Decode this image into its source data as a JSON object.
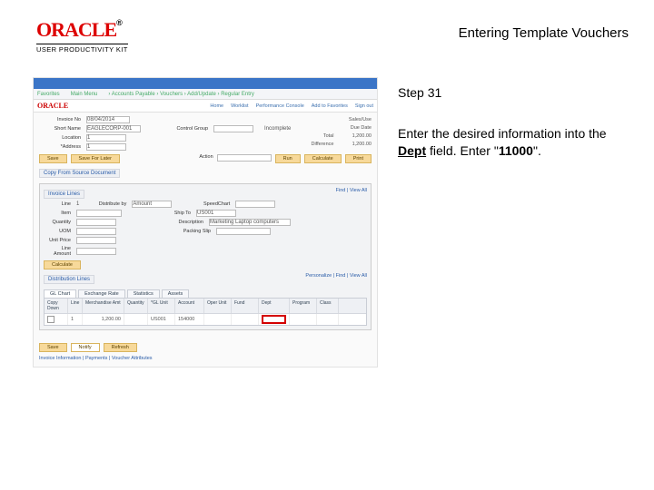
{
  "header": {
    "brand": "ORACLE",
    "brand_tm": "®",
    "subtitle": "USER PRODUCTIVITY KIT",
    "title": "Entering Template Vouchers"
  },
  "pane": {
    "step": "Step 31",
    "instr_pre": "Enter the desired information into the ",
    "instr_field": "Dept",
    "instr_mid": " field. Enter \"",
    "instr_val": "11000",
    "instr_post": "\"."
  },
  "ss": {
    "brand": "ORACLE",
    "nav_home": "Home",
    "nav_fav": "Favorites",
    "nav_main": "Main Menu",
    "nav_crumb1": "Accounts Payable",
    "nav_crumb2": "Vouchers",
    "nav_crumb3": "Add/Update",
    "nav_crumb4": "Regular Entry",
    "top_home": "Home",
    "top_wl": "Worklist",
    "top_pc": "Performance Console",
    "top_atf": "Add to Favorites",
    "top_so": "Sign out",
    "lbl_invoice": "Invoice No",
    "lbl_short": "Short Name",
    "lbl_loc": "Location",
    "lbl_addr": "*Address",
    "val_invoice": "08/04/2014",
    "val_short": "EAGLECORP-001",
    "val_loc": "1",
    "val_addr": "1",
    "lbl_ctrl": "Control Group",
    "chk_incomplete": "Incomplete",
    "r_sales": "Sales/Use",
    "r_due": "Due Date",
    "r_total": "Total",
    "r_diff": "Difference",
    "r_total_v": "1,200.00",
    "r_diff_v": "1,200.00",
    "btn_save": "Save",
    "btn_sff": "Save For Later",
    "btn_action_lbl": "Action",
    "btn_run": "Run",
    "btn_calc": "Calculate",
    "btn_print": "Print",
    "cpy_title": "Copy From Source Document",
    "inv_lines": "Invoice Lines",
    "fv_label": "Find | View All",
    "l_line": "Line",
    "l_line_v": "1",
    "l_dist": "Distribute by",
    "l_dist_v": "Amount",
    "l_item": "Item",
    "l_qty": "Quantity",
    "l_uom": "UOM",
    "l_price": "Unit Price",
    "l_la": "Line Amount",
    "l_st": "SpeedChart",
    "l_stt": "Ship To",
    "l_stt_v": "US001",
    "l_desc": "Description",
    "l_desc_v": "Marketing Laptop computers",
    "l_pack": "Packing Slip",
    "l_calc": "Calculate",
    "dist_title": "Distribution Lines",
    "tab1": "GL Chart",
    "tab2": "Exchange Rate",
    "tab3": "Statistics",
    "tab4": "Assets",
    "pcv": "Personalize | Find | View All",
    "h_copy": "Copy Down",
    "h_line": "Line",
    "h_merch": "Merchandise Amt",
    "h_qty": "Quantity",
    "h_glu": "*GL Unit",
    "h_acct": "Account",
    "h_oper": "Oper Unit",
    "h_fund": "Fund",
    "h_dept": "Dept",
    "h_prog": "Program",
    "h_pc": "Class",
    "r_line": "1",
    "r_merch": "1,200.00",
    "r_glu": "US001",
    "r_acct": "154000",
    "btn_fsave": "Save",
    "btn_notify": "Notify",
    "btn_refresh": "Refresh",
    "bottom_links": "Invoice Information | Payments | Voucher Attributes"
  }
}
